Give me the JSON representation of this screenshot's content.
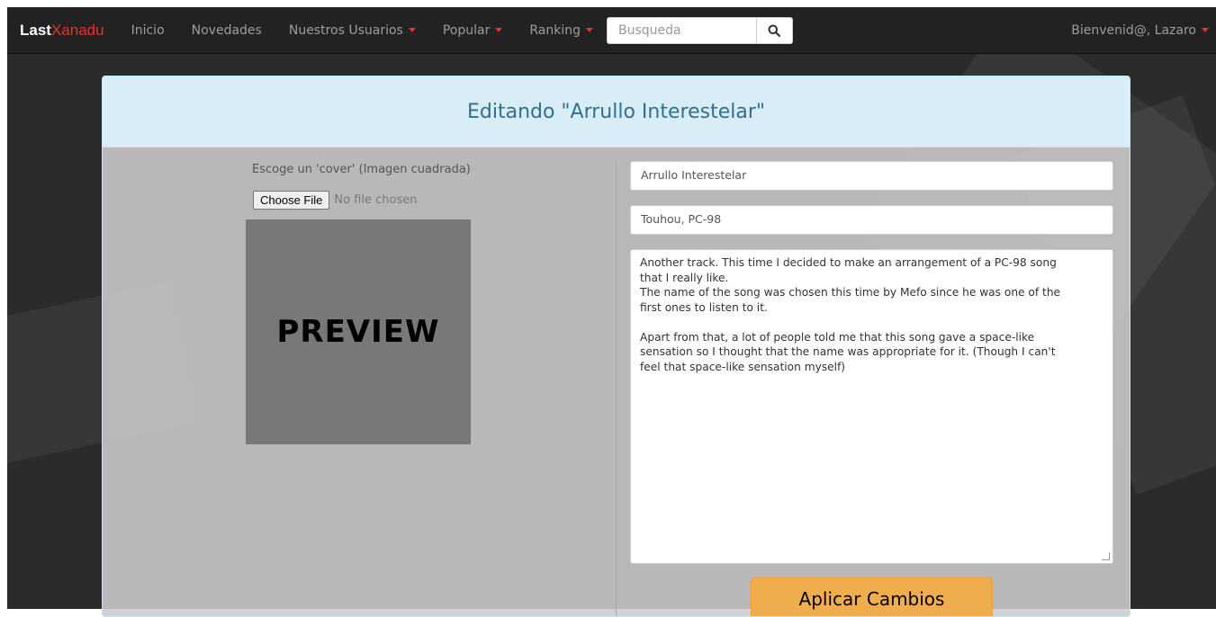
{
  "navbar": {
    "brand_part1": "Last",
    "brand_part2": "Xanadu",
    "items": [
      {
        "label": "Inicio",
        "dropdown": false
      },
      {
        "label": "Novedades",
        "dropdown": false
      },
      {
        "label": "Nuestros Usuarios",
        "dropdown": true
      },
      {
        "label": "Popular",
        "dropdown": true
      },
      {
        "label": "Ranking",
        "dropdown": true
      }
    ],
    "search_placeholder": "Busqueda",
    "search_icon": "search-icon",
    "user_greeting": "Bienvenid@, Lazaro"
  },
  "panel": {
    "title": "Editando \"Arrullo Interestelar\"",
    "cover_label": "Escoge un 'cover' (Imagen cuadrada)",
    "file_button": "Choose File",
    "file_status": "No file chosen",
    "preview_text": "PREVIEW",
    "song_title": "Arrullo Interestelar",
    "tags": "Touhou, PC-98",
    "description": "Another track. This time I decided to make an arrangement of a PC-98 song\nthat I really like.\nThe name of the song was chosen this time by Mefo since he was one of the\nfirst ones to listen to it.\n\nApart from that, a lot of people told me that this song gave a space-like\nsensation so I thought that the name was appropriate for it. (Though I can't\nfeel that space-like sensation myself)",
    "apply_button": "Aplicar Cambios"
  },
  "colors": {
    "accent": "#e8322b",
    "navbar_bg": "#222222",
    "heading_bg": "#d9edf7",
    "heading_text": "#31708f",
    "button_warning": "#f0ad4e"
  }
}
